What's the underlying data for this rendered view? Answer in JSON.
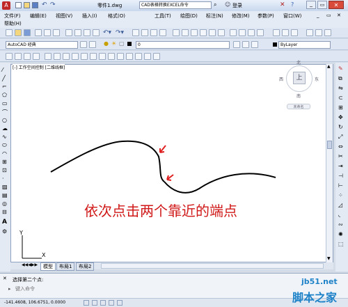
{
  "titlebar": {
    "filename": "零件1.dwg",
    "search_text": "CAD表格转换EXCEL命令",
    "login_label": "登录"
  },
  "menu": {
    "items": [
      "文件(F)",
      "编辑(E)",
      "视图(V)",
      "插入(I)",
      "格式(O)",
      "工具(T)",
      "绘图(D)",
      "标注(N)",
      "修改(M)",
      "参数(P)",
      "窗口(W)"
    ],
    "help": "帮助(H)"
  },
  "toolbar": {
    "workspace": "AutoCAD 经典",
    "layer_value": "0",
    "linetype_value": "ByLayer"
  },
  "canvas": {
    "viewport_label": "[-] 工作空间控制 [二维线框]",
    "annotation_text": "依次点击两个靠近的端点",
    "ucs_y_label": "Y",
    "ucs_x_label": "X"
  },
  "viewcube": {
    "north": "北",
    "west": "西",
    "east": "东",
    "south": "南",
    "top_face": "上",
    "wcs_label": "未命名"
  },
  "tabs": [
    "模型",
    "布局1",
    "布局2"
  ],
  "command": {
    "history_line": "选择第二个点:",
    "prompt_placeholder": "键入命令"
  },
  "status": {
    "coords": "-141.4608, 106.6751, 0.0000"
  },
  "watermark": {
    "site": "jb51.net",
    "brand": "脚本之家"
  },
  "colors": {
    "annotation": "#d01818",
    "arrow": "#e02020",
    "curve": "#000000",
    "watermark": "#1e82c8"
  }
}
